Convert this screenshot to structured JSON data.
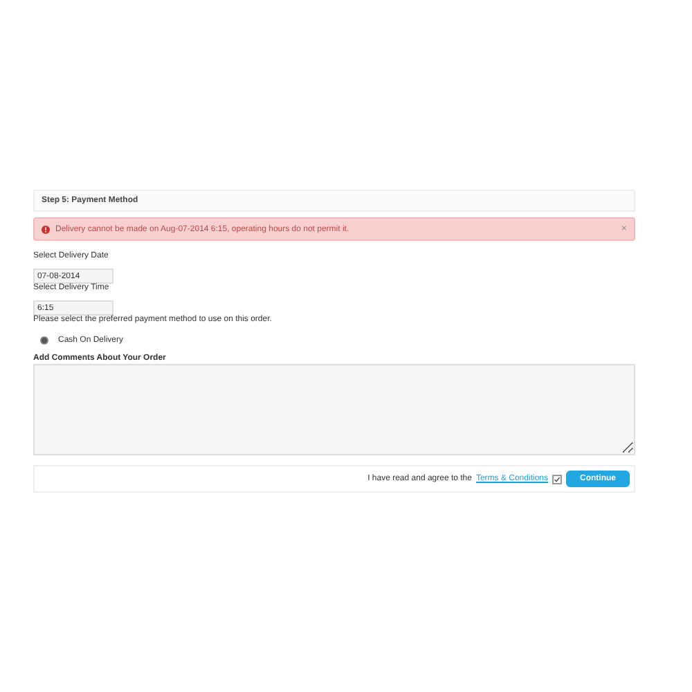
{
  "step_title": "Step 5: Payment Method",
  "alert": {
    "message": "Delivery cannot be made on Aug-07-2014 6:15, operating hours do not permit it.",
    "close": "×"
  },
  "date_label": "Select Delivery Date",
  "date_value": "07-08-2014",
  "time_label": "Select Delivery Time",
  "time_value": "6:15",
  "payment_prompt": "Please select the preferred payment method to use on this order.",
  "payment_methods": [
    {
      "label": "Cash On Delivery",
      "selected": true
    }
  ],
  "comments_label": "Add Comments About Your Order",
  "agree_text": "I have read and agree to the",
  "terms_link": "Terms & Conditions",
  "agree_checked": true,
  "continue_button": "Continue"
}
